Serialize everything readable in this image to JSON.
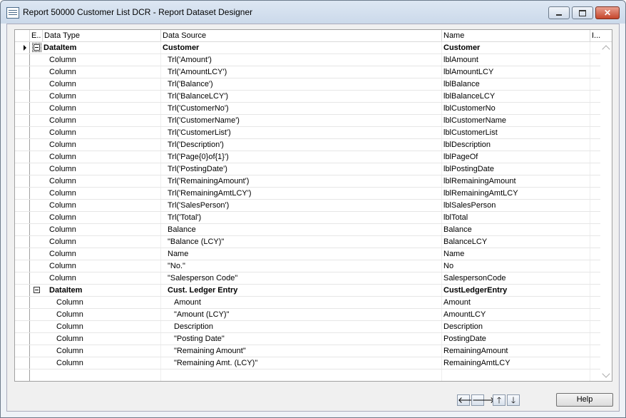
{
  "window": {
    "title": "Report 50000 Customer List DCR - Report Dataset Designer",
    "controls": {
      "minimize": "–",
      "maximize": "□",
      "close": "✕"
    }
  },
  "grid": {
    "columns": {
      "expand": "E..",
      "data_type": "Data Type",
      "data_source": "Data Source",
      "name": "Name",
      "include": "I..."
    },
    "rows": [
      {
        "expander": "minus",
        "current": true,
        "indent": 0,
        "bold": true,
        "type": "DataItem",
        "source": "Customer",
        "name": "Customer"
      },
      {
        "indent": 1,
        "type": "Column",
        "source": "Trl('Amount')",
        "name": "lblAmount"
      },
      {
        "indent": 1,
        "type": "Column",
        "source": "Trl('AmountLCY')",
        "name": "lblAmountLCY"
      },
      {
        "indent": 1,
        "type": "Column",
        "source": "Trl('Balance')",
        "name": "lblBalance"
      },
      {
        "indent": 1,
        "type": "Column",
        "source": "Trl('BalanceLCY')",
        "name": "lblBalanceLCY"
      },
      {
        "indent": 1,
        "type": "Column",
        "source": "Trl('CustomerNo')",
        "name": "lblCustomerNo"
      },
      {
        "indent": 1,
        "type": "Column",
        "source": "Trl('CustomerName')",
        "name": "lblCustomerName"
      },
      {
        "indent": 1,
        "type": "Column",
        "source": "Trl('CustomerList')",
        "name": "lblCustomerList"
      },
      {
        "indent": 1,
        "type": "Column",
        "source": "Trl('Description')",
        "name": "lblDescription"
      },
      {
        "indent": 1,
        "type": "Column",
        "source": "Trl('Page{0}of{1}')",
        "name": "lblPageOf"
      },
      {
        "indent": 1,
        "type": "Column",
        "source": "Trl('PostingDate')",
        "name": "lblPostingDate"
      },
      {
        "indent": 1,
        "type": "Column",
        "source": "Trl('RemainingAmount')",
        "name": "lblRemainingAmount"
      },
      {
        "indent": 1,
        "type": "Column",
        "source": "Trl('RemainingAmtLCY')",
        "name": "lblRemainingAmtLCY"
      },
      {
        "indent": 1,
        "type": "Column",
        "source": "Trl('SalesPerson')",
        "name": "lblSalesPerson"
      },
      {
        "indent": 1,
        "type": "Column",
        "source": "Trl('Total')",
        "name": "lblTotal"
      },
      {
        "indent": 1,
        "type": "Column",
        "source": "Balance",
        "name": "Balance"
      },
      {
        "indent": 1,
        "type": "Column",
        "source": "\"Balance (LCY)\"",
        "name": "BalanceLCY"
      },
      {
        "indent": 1,
        "type": "Column",
        "source": "Name",
        "name": "Name"
      },
      {
        "indent": 1,
        "type": "Column",
        "source": "\"No.\"",
        "name": "No"
      },
      {
        "indent": 1,
        "type": "Column",
        "source": "\"Salesperson Code\"",
        "name": "SalespersonCode"
      },
      {
        "expander": "minus",
        "indent": 2,
        "bold": true,
        "type": "DataItem",
        "source": "Cust. Ledger Entry",
        "name": "CustLedgerEntry"
      },
      {
        "indent": 3,
        "type": "Column",
        "source": "Amount",
        "name": "Amount"
      },
      {
        "indent": 3,
        "type": "Column",
        "source": "\"Amount (LCY)\"",
        "name": "AmountLCY"
      },
      {
        "indent": 3,
        "type": "Column",
        "source": "Description",
        "name": "Description"
      },
      {
        "indent": 3,
        "type": "Column",
        "source": "\"Posting Date\"",
        "name": "PostingDate"
      },
      {
        "indent": 3,
        "type": "Column",
        "source": "\"Remaining Amount\"",
        "name": "RemainingAmount"
      },
      {
        "indent": 3,
        "type": "Column",
        "source": "\"Remaining Amt. (LCY)\"",
        "name": "RemainingAmtLCY"
      },
      {
        "indent": 0,
        "type": "",
        "source": "",
        "name": ""
      }
    ]
  },
  "buttons": {
    "left": "🡐",
    "right": "🡒",
    "up": "🡑",
    "down": "🡓",
    "help": "Help"
  }
}
